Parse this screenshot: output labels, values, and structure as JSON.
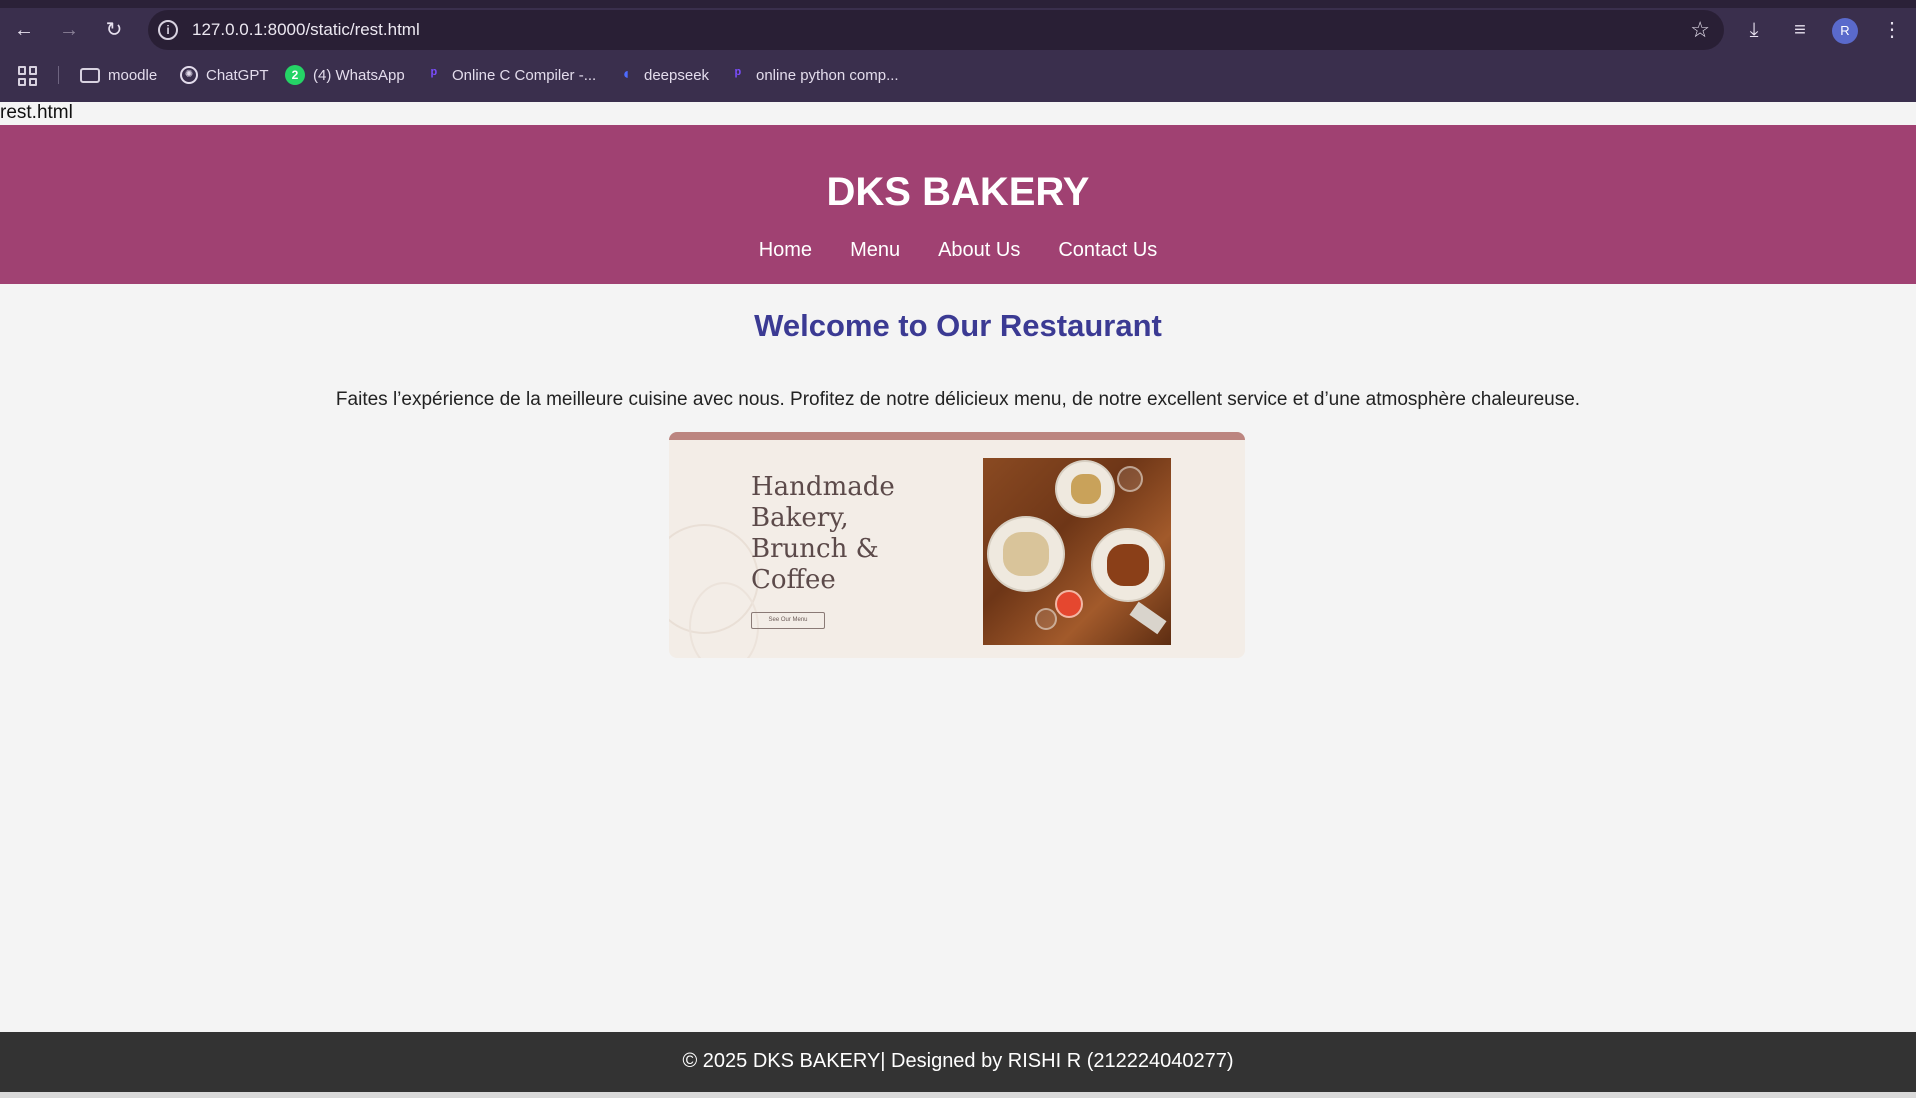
{
  "browser": {
    "url": "127.0.0.1:8000/static/rest.html",
    "avatar_letter": "R",
    "bookmarks": [
      {
        "label": "moodle",
        "icon": "folder-icon"
      },
      {
        "label": "ChatGPT",
        "icon": "chatgpt-icon"
      },
      {
        "label": "(4) WhatsApp",
        "icon": "whatsapp-icon",
        "badge": "2"
      },
      {
        "label": "Online C Compiler -...",
        "icon": "programiz-icon"
      },
      {
        "label": "deepseek",
        "icon": "deepseek-icon"
      },
      {
        "label": "online python comp...",
        "icon": "programiz-icon"
      }
    ]
  },
  "page": {
    "file_label": "rest.html",
    "header": {
      "title": "DKS BAKERY",
      "nav": [
        "Home",
        "Menu",
        "About Us",
        "Contact Us"
      ]
    },
    "welcome": "Welcome to Our Restaurant",
    "intro": "Faites l’expérience de la meilleure cuisine avec nous. Profitez de notre délicieux menu, de notre excellent service et d’une atmosphère chaleureuse.",
    "banner": {
      "heading_lines": [
        "Handmade",
        "Bakery,",
        "Brunch &",
        "Coffee"
      ],
      "button": "See Our Menu"
    },
    "footer": "© 2025 DKS BAKERY| Designed by RISHI R (212224040277)"
  },
  "colors": {
    "header_bg": "#a04172",
    "welcome_text": "#3b3a93",
    "footer_bg": "#333333",
    "chrome_bg": "#3a2f4d"
  }
}
